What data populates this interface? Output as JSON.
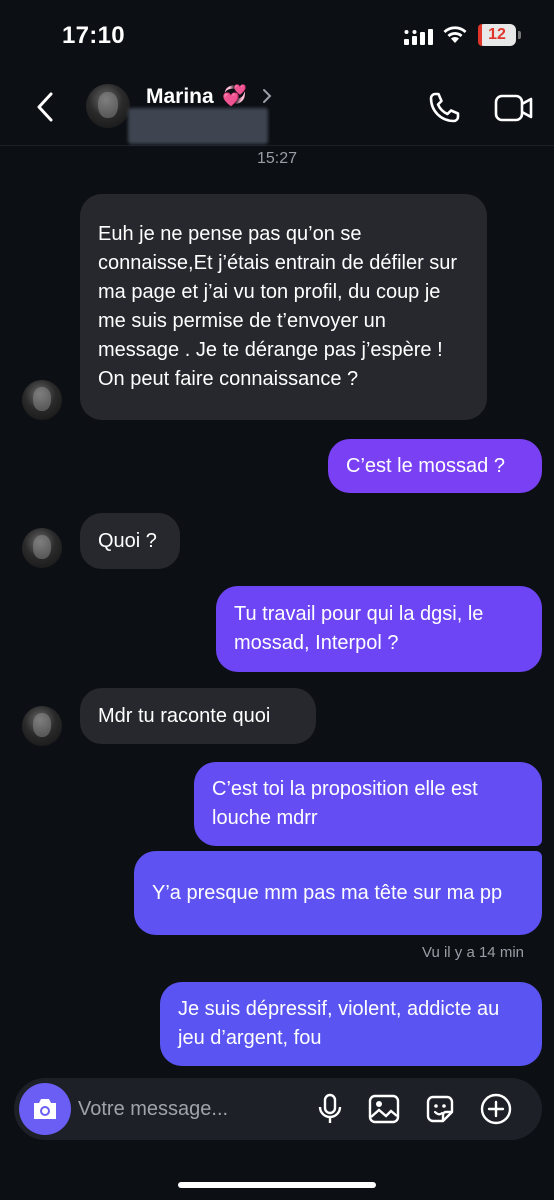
{
  "status_bar": {
    "time": "17:10",
    "battery": "12"
  },
  "header": {
    "contact_name": "Marina",
    "name_emoji": "💞"
  },
  "conversation": {
    "timestamp": "15:27",
    "messages": [
      {
        "direction": "incoming",
        "text": "Euh je ne pense pas qu’on se connaisse,Et j’étais entrain de défiler sur ma page et j’ai vu ton profil, du coup je me suis permise de t’envoyer un message . Je te dérange pas j’espère ! On peut faire connaissance ?"
      },
      {
        "direction": "outgoing",
        "text": "C’est le mossad ?"
      },
      {
        "direction": "incoming",
        "text": "Quoi ?"
      },
      {
        "direction": "outgoing",
        "text": "Tu travail pour qui la dgsi, le mossad, Interpol ?"
      },
      {
        "direction": "incoming",
        "text": "Mdr tu raconte quoi"
      },
      {
        "direction": "outgoing",
        "text": "C’est toi la proposition elle est louche mdrr"
      },
      {
        "direction": "outgoing",
        "text": "Y’a presque mm pas ma tête sur ma pp"
      },
      {
        "direction": "outgoing",
        "text": "Je suis dépressif, violent, addicte au jeu d’argent, fou"
      }
    ],
    "seen_label": "Vu il y a 14 min"
  },
  "composer": {
    "placeholder": "Votre message..."
  },
  "colors": {
    "background": "#0c0f14",
    "incoming_bubble": "#26282e",
    "outgoing_gradient_top": "#9a3cf4",
    "outgoing_gradient_bottom": "#5a55f2",
    "camera_button": "#6a5ef5",
    "battery_low": "#e0352b"
  },
  "icons": [
    "back-icon",
    "phone-icon",
    "video-call-icon",
    "camera-icon",
    "microphone-icon",
    "gallery-icon",
    "sticker-icon",
    "add-icon"
  ]
}
